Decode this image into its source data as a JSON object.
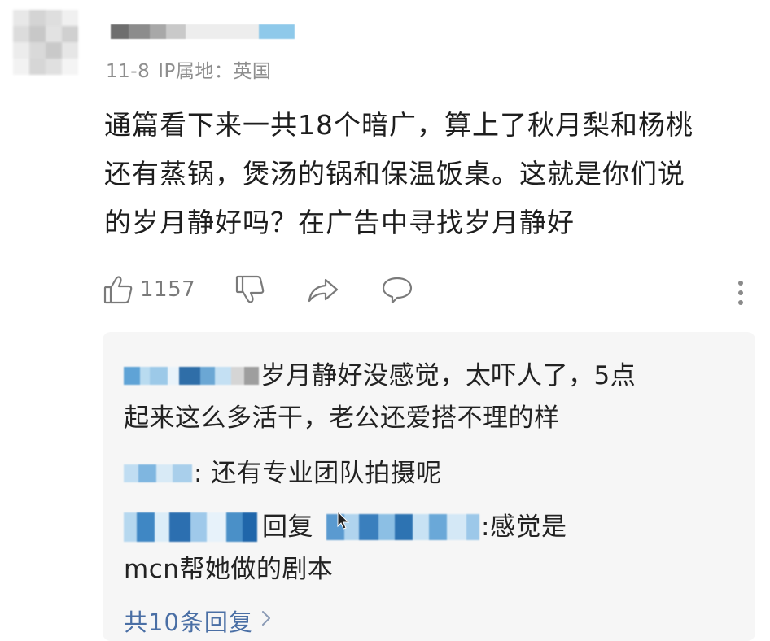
{
  "comment": {
    "meta": {
      "date": "11-8",
      "ip_label": "IP属地：英国"
    },
    "content_lines": [
      "通篇看下来一共18个暗广，算上了秋月梨和杨桃",
      "还有蒸锅，煲汤的锅和保温饭桌。这就是你们说",
      "的岁月静好吗？在广告中寻找岁月静好"
    ],
    "actions": {
      "like_count": "1157"
    }
  },
  "replies": {
    "items": [
      {
        "lines": [
          "岁月静好没感觉，太吓人了，5点",
          "起来这么多活干，老公还爱搭不理的样"
        ]
      },
      {
        "lines": [
          ": 还有专业团队拍摄呢"
        ]
      },
      {
        "reply_word": "回复",
        "lines": [
          ":感觉是",
          "mcn帮她做的剧本"
        ]
      }
    ],
    "view_all": "共10条回复"
  },
  "colors": {
    "link": "#4a6fa5",
    "meta": "#8e8e8e",
    "reply_bg": "#f6f6f6"
  }
}
